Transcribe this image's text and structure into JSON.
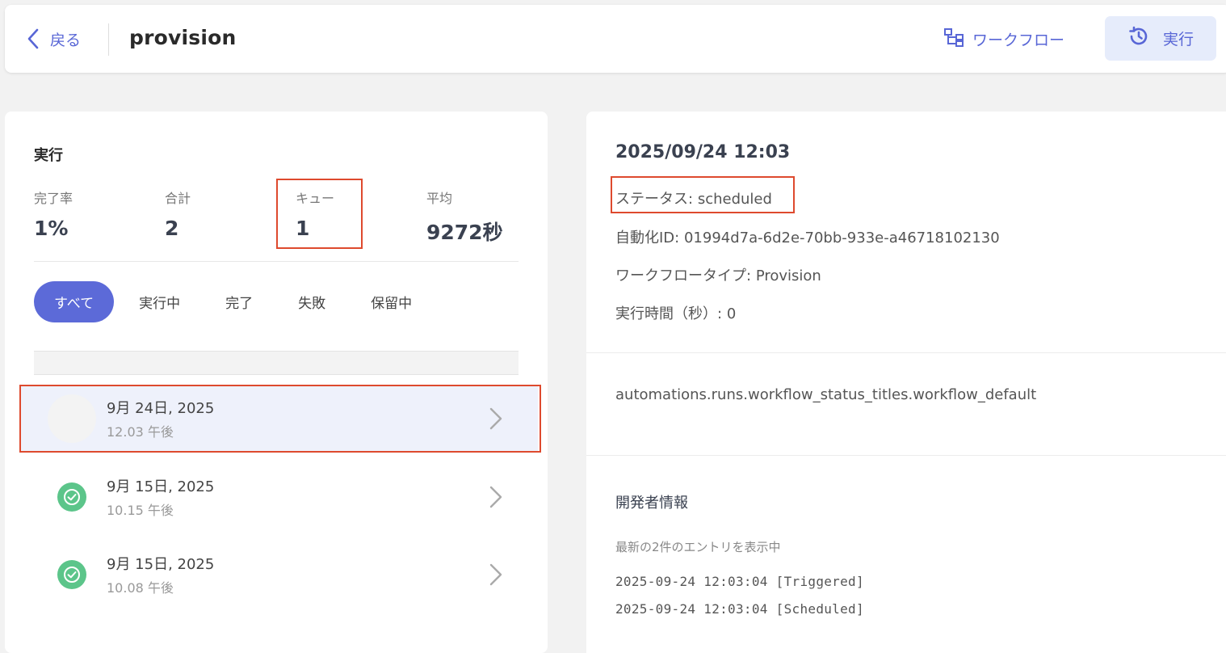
{
  "header": {
    "back_label": "戻る",
    "title": "provision",
    "workflow_label": "ワークフロー",
    "run_label": "実行"
  },
  "executions": {
    "section_title": "実行",
    "stats": [
      {
        "label": "完了率",
        "value": "1%"
      },
      {
        "label": "合計",
        "value": "2"
      },
      {
        "label": "キュー",
        "value": "1"
      },
      {
        "label": "平均",
        "value": "9272秒"
      }
    ],
    "filters": [
      "すべて",
      "実行中",
      "完了",
      "失敗",
      "保留中"
    ],
    "active_filter": "すべて",
    "runs": [
      {
        "date": "9月 24日, 2025",
        "time": "12.03 午後",
        "status": "scheduled",
        "selected": true
      },
      {
        "date": "9月 15日, 2025",
        "time": "10.15 午後",
        "status": "completed",
        "selected": false
      },
      {
        "date": "9月 15日, 2025",
        "time": "10.08 午後",
        "status": "completed",
        "selected": false
      }
    ]
  },
  "detail": {
    "title": "2025/09/24 12:03",
    "status_label": "ステータス:",
    "status_value": "scheduled",
    "automation_id_label": "自動化ID:",
    "automation_id_value": "01994d7a-6d2e-70bb-933e-a46718102130",
    "workflow_type_label": "ワークフロータイプ:",
    "workflow_type_value": "Provision",
    "duration_label": "実行時間（秒）:",
    "duration_value": "0",
    "message": "automations.runs.workflow_status_titles.workflow_default",
    "developer_title": "開発者情報",
    "developer_subtitle": "最新の2件のエントリを表示中",
    "logs": [
      "2025-09-24 12:03:04 [Triggered]",
      "2025-09-24 12:03:04 [Scheduled]"
    ]
  },
  "colors": {
    "accent": "#5866d6",
    "active_pill": "#5c6ad8",
    "highlight_border": "#de4a2e",
    "success": "#5cc58a",
    "selected_row": "#eef1fb"
  },
  "icons": [
    "chevron-left-icon",
    "workflow-icon",
    "history-icon",
    "check-circle-icon",
    "chevron-right-icon"
  ]
}
